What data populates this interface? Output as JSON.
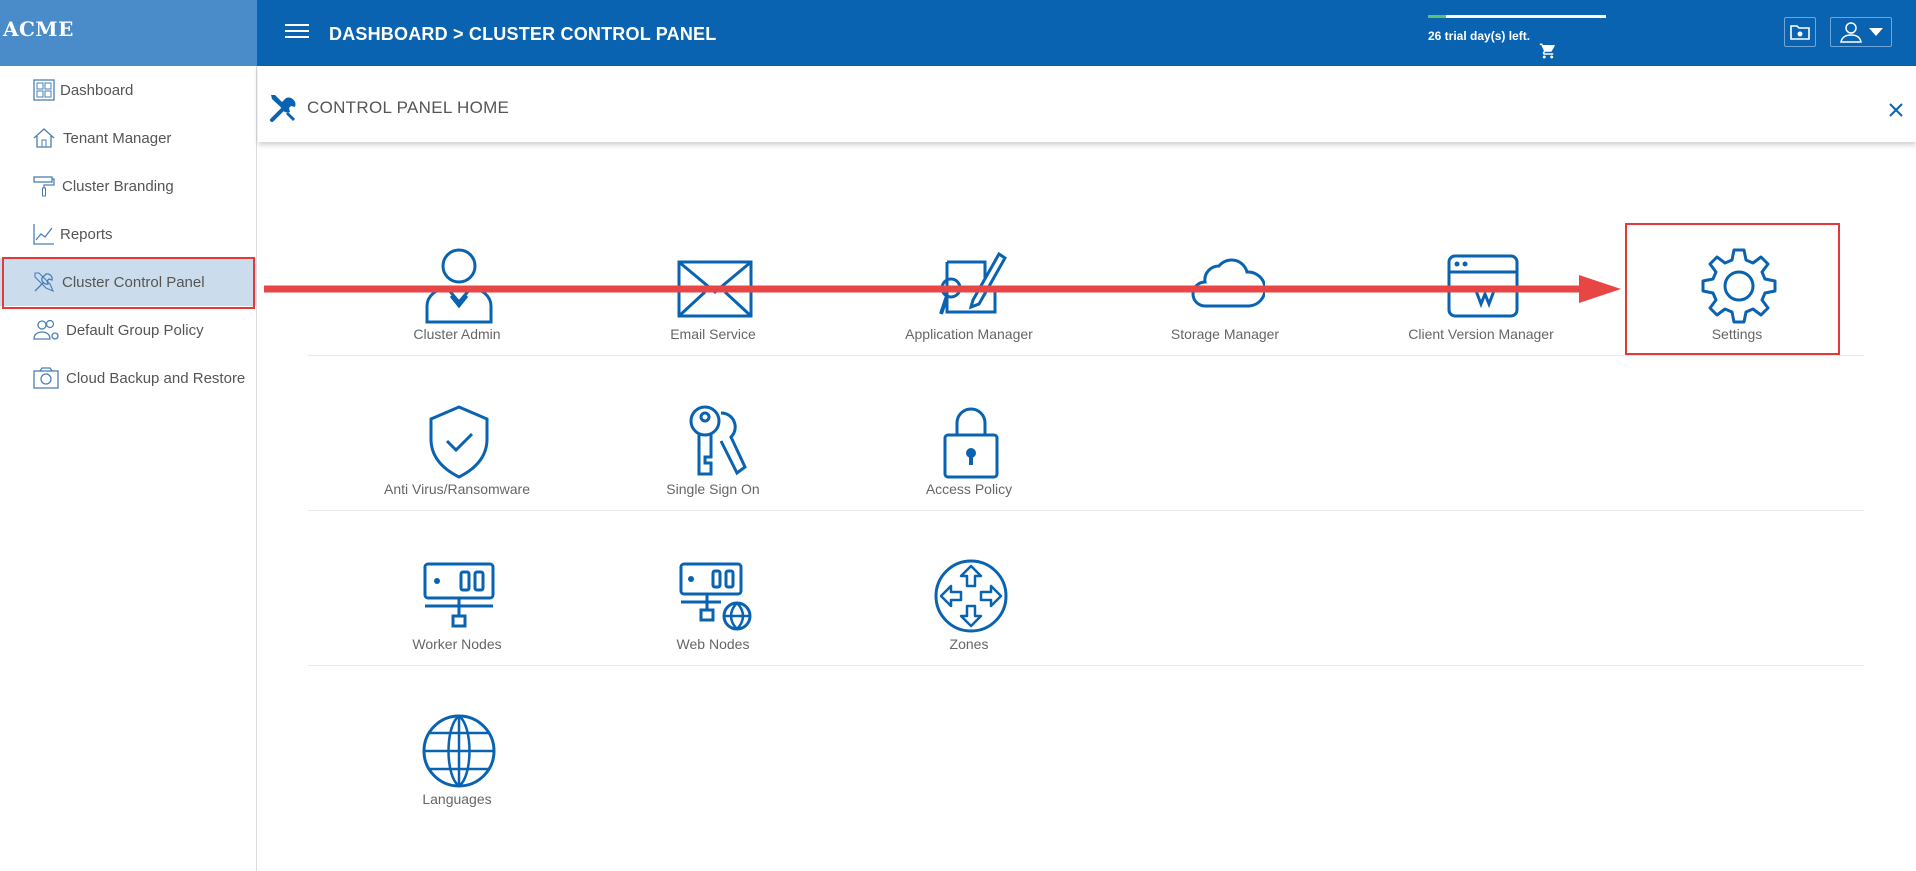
{
  "header": {
    "brand": "ACME",
    "breadcrumb": "DASHBOARD > CLUSTER CONTROL PANEL",
    "trial_text": "26 trial day(s) left.",
    "trial_progress": 0.1,
    "accent_color": "#0a63b1"
  },
  "sidebar": {
    "items": [
      {
        "label": "Dashboard",
        "icon": "dashboard-icon"
      },
      {
        "label": "Tenant Manager",
        "icon": "tenant-icon"
      },
      {
        "label": "Cluster Branding",
        "icon": "paint-roller-icon"
      },
      {
        "label": "Reports",
        "icon": "chart-icon"
      },
      {
        "label": "Cluster Control Panel",
        "icon": "tools-icon",
        "active": true
      },
      {
        "label": "Default Group Policy",
        "icon": "group-icon"
      },
      {
        "label": "Cloud Backup and Restore",
        "icon": "camera-icon"
      }
    ]
  },
  "panel": {
    "title": "CONTROL PANEL HOME",
    "tiles": [
      {
        "label": "Cluster Admin",
        "icon": "user-admin-icon"
      },
      {
        "label": "Email Service",
        "icon": "envelope-icon"
      },
      {
        "label": "Application Manager",
        "icon": "app-manager-icon"
      },
      {
        "label": "Storage Manager",
        "icon": "cloud-icon"
      },
      {
        "label": "Client Version Manager",
        "icon": "browser-window-icon"
      },
      {
        "label": "Settings",
        "icon": "gear-icon"
      },
      {
        "label": "Anti Virus/Ransomware",
        "icon": "shield-check-icon"
      },
      {
        "label": "Single Sign On",
        "icon": "keys-icon"
      },
      {
        "label": "Access Policy",
        "icon": "padlock-icon"
      },
      {
        "label": "Worker Nodes",
        "icon": "server-icon"
      },
      {
        "label": "Web Nodes",
        "icon": "server-globe-icon"
      },
      {
        "label": "Zones",
        "icon": "zones-arrows-icon"
      },
      {
        "label": "Languages",
        "icon": "globe-icon"
      }
    ]
  },
  "annotation_color": "#e23a3a"
}
